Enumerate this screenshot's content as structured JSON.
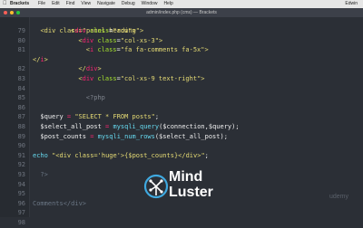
{
  "menubar": {
    "apple": "",
    "app": "Brackets",
    "menus": [
      "File",
      "Edit",
      "Find",
      "View",
      "Navigate",
      "Debug",
      "Window",
      "Help"
    ],
    "right_items": [
      "Edwin"
    ]
  },
  "window": {
    "title": "admin/index.php (cms) — Brackets",
    "lights": [
      "#ff5f57",
      "#febc2e",
      "#28c840"
    ]
  },
  "editor": {
    "lines": [
      {
        "n": "79",
        "indent": 10,
        "parts": [
          [
            "tag",
            "<"
          ],
          [
            "tagname",
            "div"
          ],
          [
            "attr",
            " class"
          ],
          [
            "var",
            "="
          ],
          [
            "str",
            "\"row\""
          ],
          [
            "tag",
            ">"
          ]
        ]
      },
      {
        "n": "80",
        "indent": 12,
        "parts": [
          [
            "tag",
            "<"
          ],
          [
            "tagname",
            "div"
          ],
          [
            "attr",
            " class"
          ],
          [
            "var",
            "="
          ],
          [
            "str",
            "\"col-xs-3\""
          ],
          [
            "tag",
            ">"
          ]
        ]
      },
      {
        "n": "81",
        "indent": 14,
        "parts": [
          [
            "tag",
            "<"
          ],
          [
            "tagname",
            "i"
          ],
          [
            "attr",
            " class"
          ],
          [
            "var",
            "="
          ],
          [
            "str",
            "\"fa fa-comments fa-5x\""
          ],
          [
            "tag",
            ">"
          ]
        ]
      },
      {
        "n": "",
        "indent": 0,
        "parts": [
          [
            "tag",
            "</"
          ],
          [
            "tagname",
            "i"
          ],
          [
            "tag",
            ">"
          ]
        ]
      },
      {
        "n": "82",
        "indent": 12,
        "parts": [
          [
            "tag",
            "</"
          ],
          [
            "tagname",
            "div"
          ],
          [
            "tag",
            ">"
          ]
        ]
      },
      {
        "n": "83",
        "indent": 12,
        "parts": [
          [
            "tag",
            "<"
          ],
          [
            "tagname",
            "div"
          ],
          [
            "attr",
            " class"
          ],
          [
            "var",
            "="
          ],
          [
            "str",
            "\"col-xs-9 text-right\""
          ],
          [
            "tag",
            ">"
          ]
        ]
      },
      {
        "n": "84",
        "indent": 0,
        "parts": []
      },
      {
        "n": "85",
        "indent": 14,
        "parts": [
          [
            "dim",
            "<?php"
          ]
        ]
      },
      {
        "n": "86",
        "indent": 0,
        "parts": []
      },
      {
        "n": "87",
        "indent": 2,
        "parts": [
          [
            "var",
            "$query "
          ],
          [
            "op",
            "= "
          ],
          [
            "str",
            "\"SELECT * FROM posts\""
          ],
          [
            "var",
            ";"
          ]
        ]
      },
      {
        "n": "88",
        "indent": 2,
        "parts": [
          [
            "var",
            "$select_all_post "
          ],
          [
            "op",
            "= "
          ],
          [
            "fn",
            "mysqli_query"
          ],
          [
            "var",
            "($connection,$query);"
          ]
        ]
      },
      {
        "n": "89",
        "indent": 2,
        "parts": [
          [
            "var",
            "$post_counts "
          ],
          [
            "op",
            "= "
          ],
          [
            "fn",
            "mysqli_num_rows"
          ],
          [
            "var",
            "($select_all_post);"
          ]
        ]
      },
      {
        "n": "90",
        "indent": 0,
        "parts": []
      },
      {
        "n": "91",
        "indent": 0,
        "parts": [
          [
            "fn",
            "echo "
          ],
          [
            "str",
            "\"<div class='huge'>{$post_counts}</div>\""
          ],
          [
            "var",
            ";"
          ]
        ]
      },
      {
        "n": "92",
        "indent": 0,
        "parts": []
      },
      {
        "n": "93",
        "indent": 2,
        "parts": [
          [
            "cmt",
            "?>"
          ]
        ]
      },
      {
        "n": "94",
        "indent": 0,
        "parts": []
      },
      {
        "n": "95",
        "indent": 0,
        "parts": []
      },
      {
        "n": "96",
        "indent": 0,
        "parts": [
          [
            "cmt",
            "Comments</div>"
          ]
        ]
      },
      {
        "n": "97",
        "indent": 0,
        "parts": []
      },
      {
        "n": "98",
        "indent": 0,
        "parts": []
      }
    ],
    "top_partial": "<div class=\"panel-heading\">"
  },
  "overlay": {
    "logo_line1": "Mind",
    "logo_line2": "Luster",
    "logo_color": "#3fa9e0",
    "watermark": "udemy"
  }
}
